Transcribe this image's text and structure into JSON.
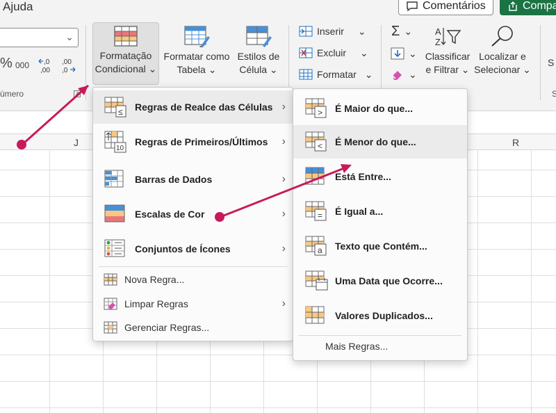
{
  "ribbon": {
    "tab_help": "Ajuda",
    "comments_button": "Comentários",
    "share_button": "Compa",
    "number_format": {
      "percent": "%",
      "thousands": "000",
      "increase_decimal": "←,0\n,00",
      "decrease_decimal": ",00\n→,0"
    },
    "number_group_label": "úmero",
    "conditional_formatting": {
      "line1": "Formatação",
      "line2": "Condicional"
    },
    "format_as_table": {
      "line1": "Formatar como",
      "line2": "Tabela"
    },
    "cell_styles": {
      "line1": "Estilos de",
      "line2": "Célula"
    },
    "cells": {
      "insert": "Inserir",
      "delete": "Excluir",
      "format": "Formatar"
    },
    "editing": {
      "autosum": "Σ",
      "sort_filter": {
        "line1": "Classificar",
        "line2": "e Filtrar"
      },
      "find_select": {
        "line1": "Localizar e",
        "line2": "Selecionar"
      }
    },
    "cut_label_s": "S",
    "cut_label_sub": "S"
  },
  "grid": {
    "columns": [
      "J",
      "R"
    ]
  },
  "menu_main": {
    "items": [
      {
        "label": "Regras de Realce das Células",
        "icon": "highlight-cells-icon"
      },
      {
        "label": "Regras de Primeiros/Últimos",
        "icon": "top-bottom-icon"
      },
      {
        "label": "Barras de Dados",
        "icon": "data-bars-icon"
      },
      {
        "label": "Escalas de Cor",
        "icon": "color-scales-icon"
      },
      {
        "label": "Conjuntos de Ícones",
        "icon": "icon-sets-icon"
      }
    ],
    "actions": [
      {
        "label": "Nova Regra...",
        "icon": "new-rule-icon"
      },
      {
        "label": "Limpar Regras",
        "icon": "clear-rules-icon"
      },
      {
        "label": "Gerenciar Regras...",
        "icon": "manage-rules-icon"
      }
    ]
  },
  "menu_sub": {
    "items": [
      {
        "label": "É Maior do que...",
        "icon": "greater-than-icon",
        "glyph": ">"
      },
      {
        "label": "É Menor do que...",
        "icon": "less-than-icon",
        "glyph": "<"
      },
      {
        "label": "Está Entre...",
        "icon": "between-icon"
      },
      {
        "label": "É Igual a...",
        "icon": "equal-to-icon",
        "glyph": "="
      },
      {
        "label": "Texto que Contém...",
        "icon": "text-contains-icon",
        "glyph": "a"
      },
      {
        "label": "Uma Data que Ocorre...",
        "icon": "date-occurring-icon"
      },
      {
        "label": "Valores Duplicados...",
        "icon": "duplicate-values-icon"
      }
    ],
    "more_rules": "Mais Regras..."
  },
  "colors": {
    "accent_arrow": "#c8195a",
    "excel_green": "#1a7343",
    "highlight_orange": "#f8c880",
    "highlight_red": "#e8767b",
    "highlight_blue": "#4a8fd6"
  }
}
